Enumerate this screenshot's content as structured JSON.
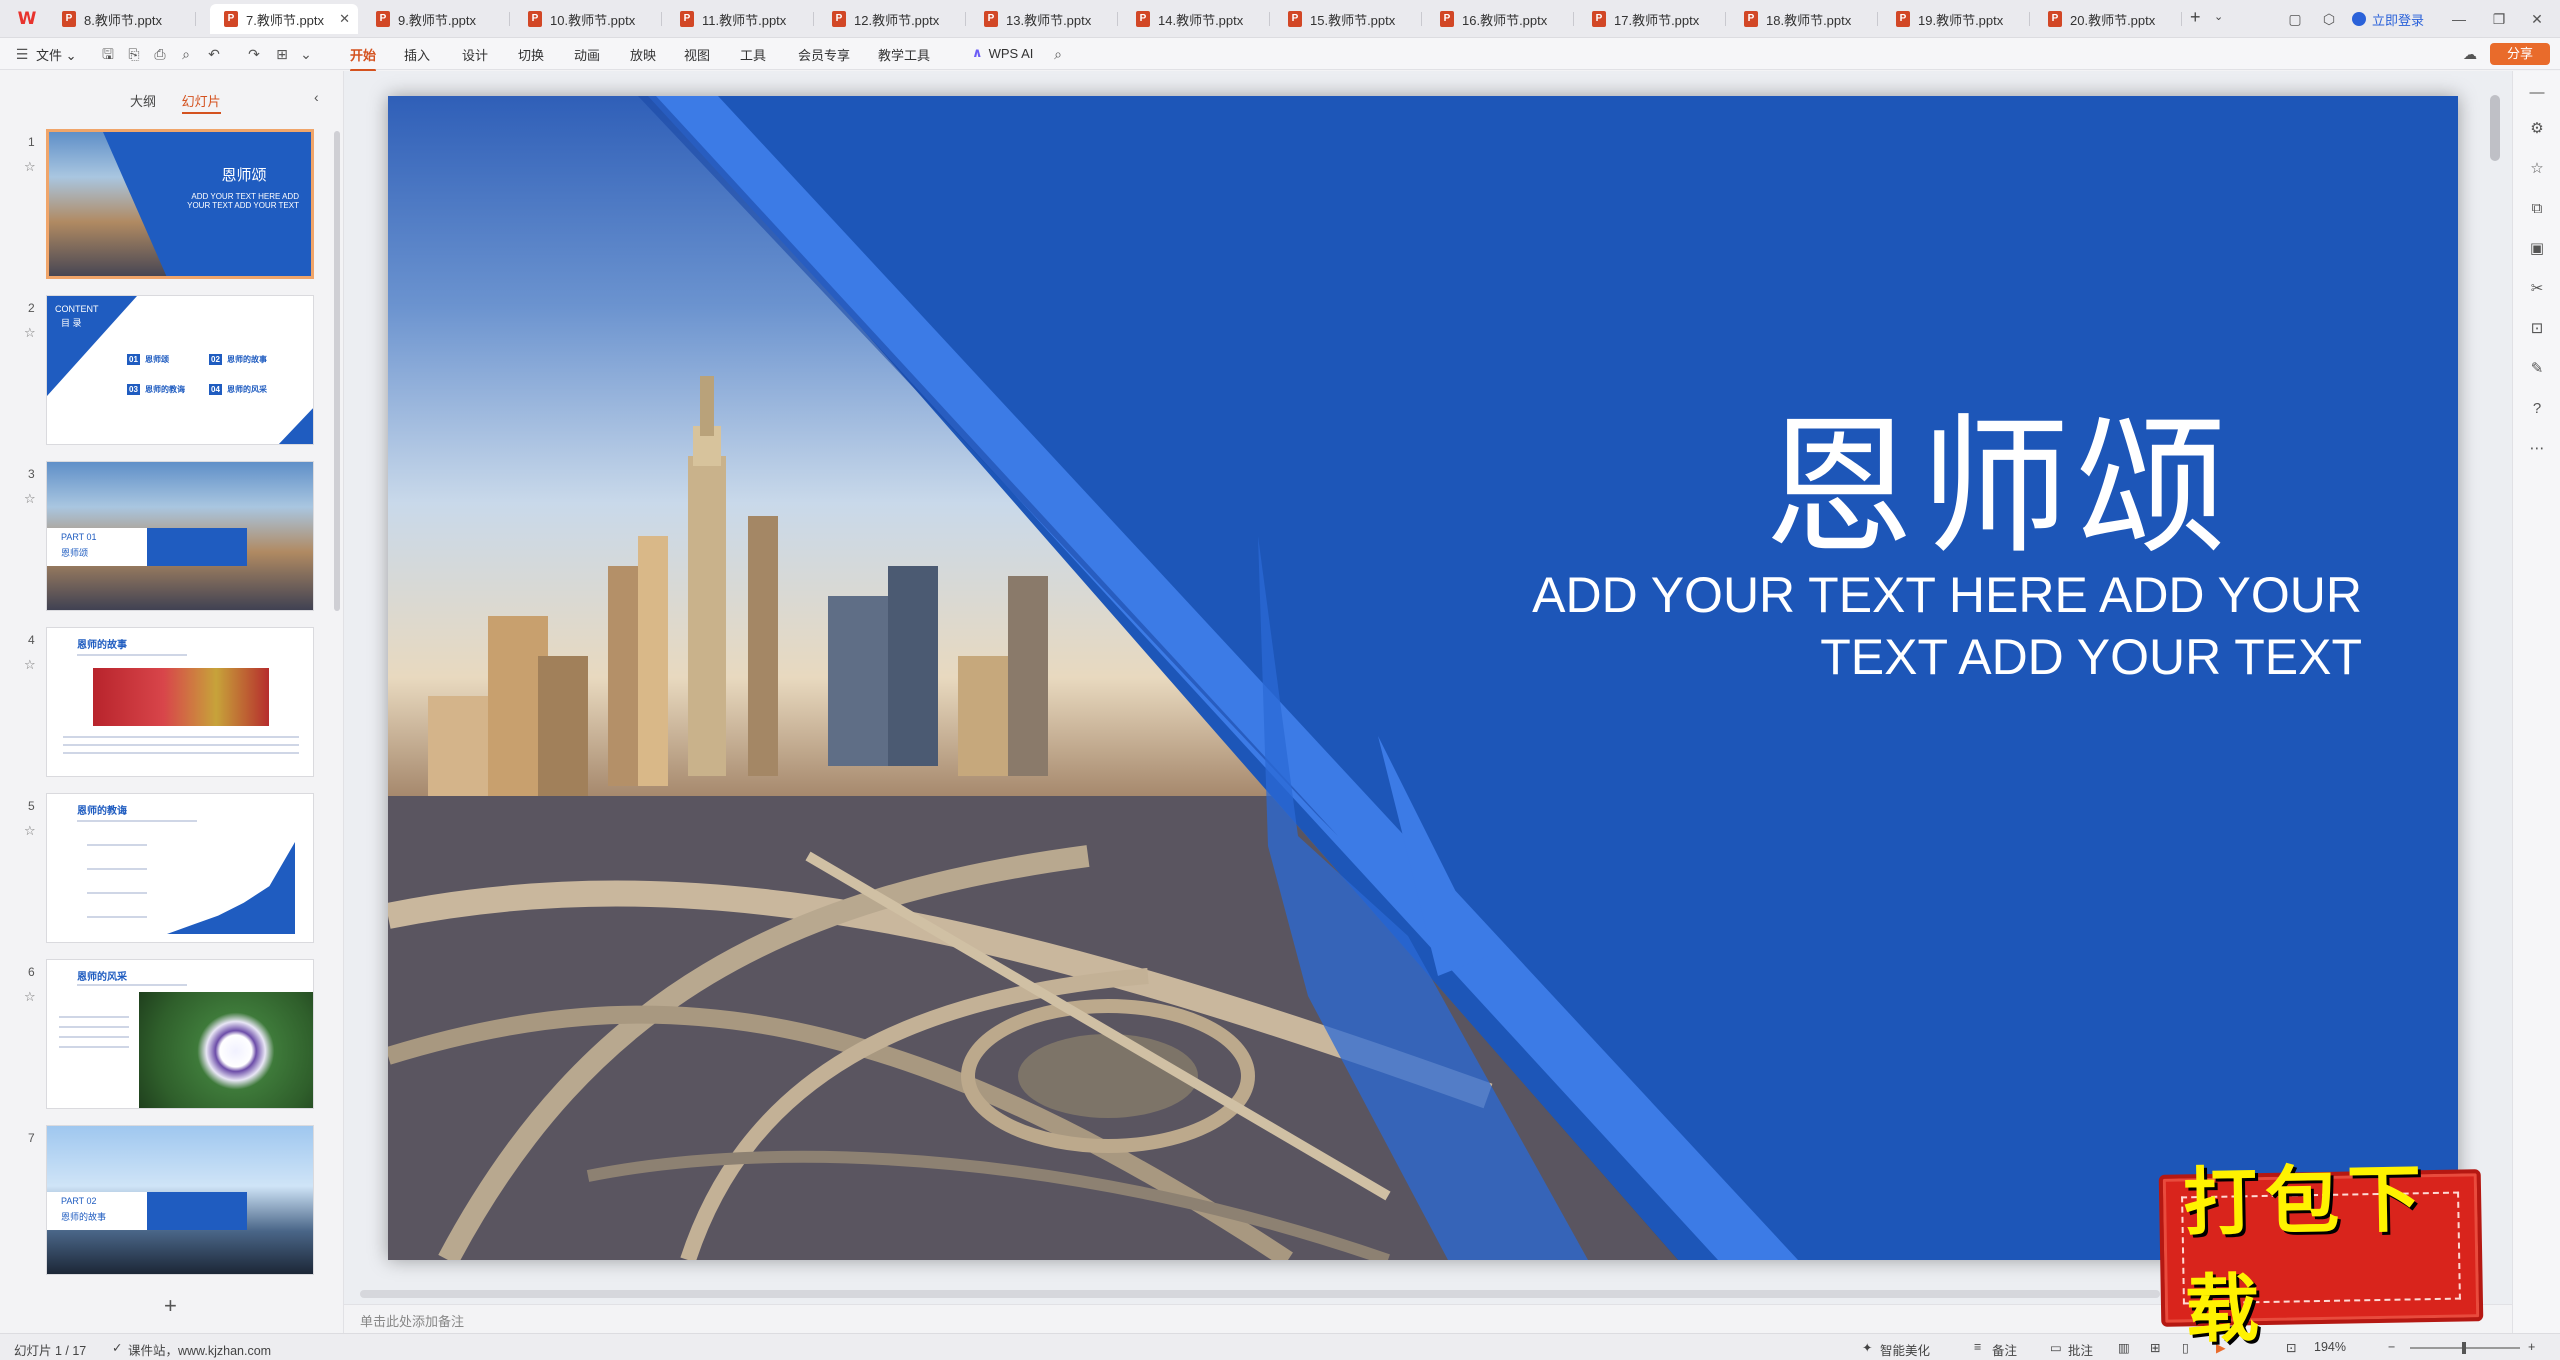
{
  "tabs": [
    {
      "label": "8.教师节.pptx",
      "active": false
    },
    {
      "label": "7.教师节.pptx",
      "active": true
    },
    {
      "label": "9.教师节.pptx",
      "active": false
    },
    {
      "label": "10.教师节.pptx",
      "active": false
    },
    {
      "label": "11.教师节.pptx",
      "active": false
    },
    {
      "label": "12.教师节.pptx",
      "active": false
    },
    {
      "label": "13.教师节.pptx",
      "active": false
    },
    {
      "label": "14.教师节.pptx",
      "active": false
    },
    {
      "label": "15.教师节.pptx",
      "active": false
    },
    {
      "label": "16.教师节.pptx",
      "active": false
    },
    {
      "label": "17.教师节.pptx",
      "active": false
    },
    {
      "label": "18.教师节.pptx",
      "active": false
    },
    {
      "label": "19.教师节.pptx",
      "active": false
    },
    {
      "label": "20.教师节.pptx",
      "active": false
    }
  ],
  "titlebar": {
    "login": "立即登录"
  },
  "ribbon": {
    "file_menu": "文件",
    "tabs": [
      "开始",
      "插入",
      "设计",
      "切换",
      "动画",
      "放映",
      "视图",
      "工具",
      "会员专享",
      "教学工具"
    ],
    "active_tab": "开始",
    "ai_label": "WPS AI",
    "share": "分享"
  },
  "panel": {
    "view_outline": "大纲",
    "view_slides": "幻灯片",
    "selected_slide": 1
  },
  "thumbnails": {
    "s1": {
      "num": "1",
      "title": "恩师颂",
      "sub": "ADD YOUR TEXT HERE ADD YOUR TEXT ADD YOUR TEXT"
    },
    "s2": {
      "num": "2",
      "content_en": "CONTENT",
      "content_cn": "目 录",
      "items": [
        "01",
        "恩师颂",
        "02",
        "恩师的故事",
        "03",
        "恩师的教诲",
        "04",
        "恩师的风采"
      ]
    },
    "s3": {
      "num": "3",
      "part": "PART 01",
      "name": "恩师颂"
    },
    "s4": {
      "num": "4",
      "title": "恩师的故事"
    },
    "s5": {
      "num": "5",
      "title": "恩师的教诲"
    },
    "s6": {
      "num": "6",
      "title": "恩师的风采"
    },
    "s7": {
      "num": "7",
      "part": "PART 02",
      "name": "恩师的故事"
    }
  },
  "slide": {
    "title": "恩师颂",
    "subtitle_line1": "ADD YOUR TEXT HERE ADD YOUR",
    "subtitle_line2": "TEXT ADD YOUR TEXT"
  },
  "notes_placeholder": "单击此处添加备注",
  "status": {
    "slide_counter": "幻灯片 1 / 17",
    "source": "课件站，www.kjzhan.com",
    "smart_beautify": "智能美化",
    "notes": "备注",
    "comments": "批注",
    "zoom": "194%"
  },
  "watermark": {
    "text": "打包下载"
  },
  "colors": {
    "accent": "#d4521f",
    "slide_blue": "#1d56b8",
    "stamp_red": "#d9241c",
    "stamp_text": "#fff200"
  }
}
